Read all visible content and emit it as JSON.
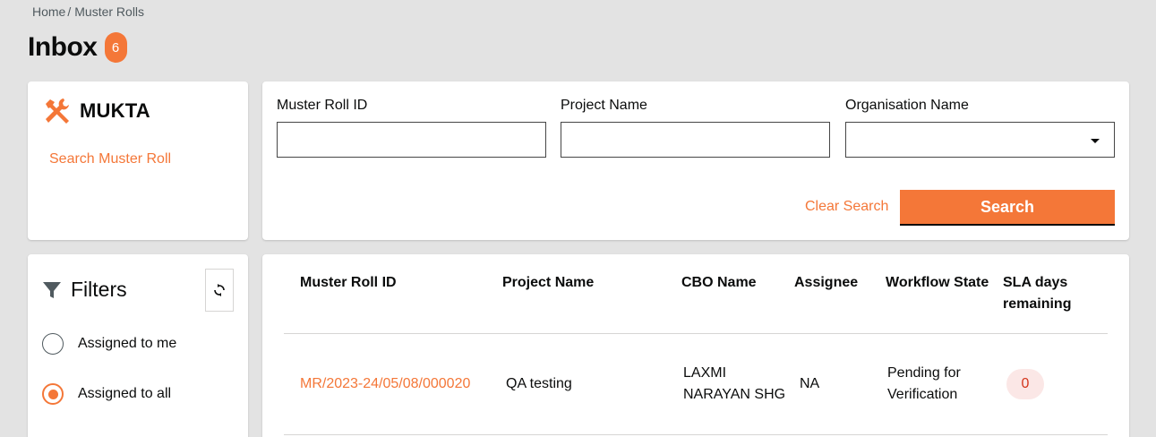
{
  "breadcrumb": {
    "home": "Home",
    "separator": "/",
    "current": "Muster Rolls"
  },
  "header": {
    "title": "Inbox",
    "count": "6"
  },
  "module": {
    "icon": "hammer-wrench-icon",
    "name": "MUKTA",
    "link": "Search Muster Roll"
  },
  "search": {
    "fields": [
      {
        "label": "Muster Roll ID",
        "value": ""
      },
      {
        "label": "Project Name",
        "value": ""
      },
      {
        "label": "Organisation Name",
        "value": ""
      }
    ],
    "clear_label": "Clear Search",
    "search_label": "Search"
  },
  "filters": {
    "title": "Filters",
    "icon": "funnel-icon",
    "refresh_icon": "refresh-icon",
    "options": [
      {
        "label": "Assigned to me",
        "checked": false
      },
      {
        "label": "Assigned to all",
        "checked": true
      }
    ]
  },
  "table": {
    "headers": [
      "Muster Roll ID",
      "Project Name",
      "CBO Name",
      "Assignee",
      "Workflow State",
      "SLA days remaining"
    ],
    "rows": [
      {
        "id": "MR/2023-24/05/08/000020",
        "project": "QA testing",
        "cbo": "LAXMI NARAYAN SHG",
        "assignee": "NA",
        "state": "Pending for Verification",
        "sla": "0"
      }
    ]
  },
  "colors": {
    "accent": "#f47738",
    "background": "#e3e3e3",
    "sla_bg": "#fbe7e6",
    "sla_text": "#d4351c"
  }
}
